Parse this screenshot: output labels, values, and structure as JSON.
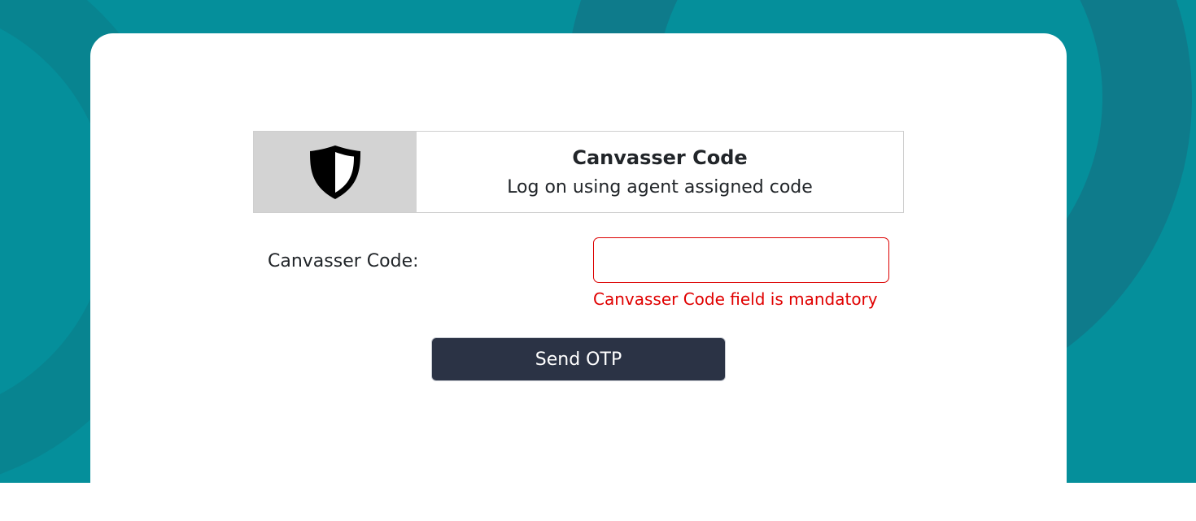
{
  "banner": {
    "icon": "shield-icon",
    "title": "Canvasser Code",
    "subtitle": "Log on using agent assigned code"
  },
  "form": {
    "label": "Canvasser Code:",
    "input_value": "",
    "input_placeholder": "",
    "error": "Canvasser Code field is mandatory",
    "submit_label": "Send OTP"
  },
  "colors": {
    "background": "#058f9b",
    "card": "#ffffff",
    "icon_box": "#d3d3d3",
    "error": "#e00000",
    "button": "#2b3345"
  }
}
